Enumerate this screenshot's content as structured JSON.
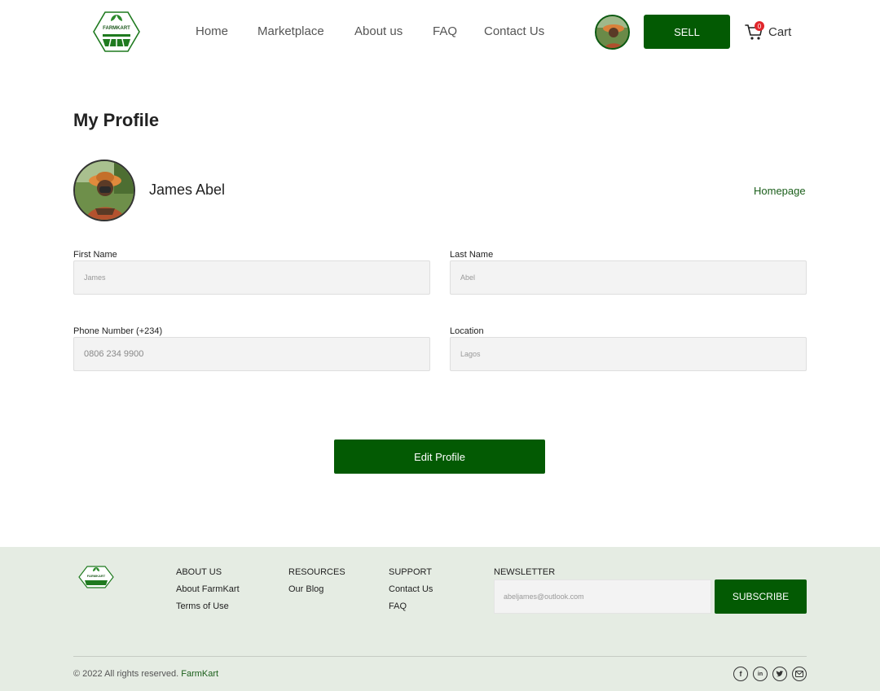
{
  "header": {
    "logo_text": "FARMKART",
    "nav": [
      {
        "label": "Home"
      },
      {
        "label": "Marketplace"
      },
      {
        "label": "About us"
      },
      {
        "label": "FAQ"
      },
      {
        "label": "Contact Us"
      }
    ],
    "sell_label": "SELL",
    "cart_label": "Cart",
    "cart_count": "0"
  },
  "profile": {
    "title": "My Profile",
    "name": "James Abel",
    "homepage_link": "Homepage",
    "fields": {
      "first_name": {
        "label": "First Name",
        "value": "James"
      },
      "last_name": {
        "label": "Last Name",
        "value": "Abel"
      },
      "phone": {
        "label": "Phone Number (+234)",
        "value": "0806 234 9900"
      },
      "location": {
        "label": "Location",
        "value": "Lagos"
      }
    },
    "edit_label": "Edit Profile"
  },
  "footer": {
    "logo_text": "FARMKART",
    "about": {
      "heading": "ABOUT US",
      "items": [
        "About FarmKart",
        "Terms of Use"
      ]
    },
    "resources": {
      "heading": "RESOURCES",
      "items": [
        "Our Blog"
      ]
    },
    "support": {
      "heading": "SUPPORT",
      "items": [
        "Contact Us",
        "FAQ"
      ]
    },
    "newsletter": {
      "heading": "NEWSLETTER",
      "placeholder": "abeljames@outlook.com",
      "subscribe_label": "SUBSCRIBE"
    },
    "copyright_text": "© 2022 All rights reserved.",
    "copyright_brand": "FarmKart",
    "socials": [
      "facebook-icon",
      "linkedin-icon",
      "twitter-icon",
      "mail-icon"
    ]
  },
  "colors": {
    "brand_green": "#035a03",
    "link_green": "#1a5e1a",
    "footer_bg": "#e5ece3",
    "badge_red": "#e0262b"
  }
}
